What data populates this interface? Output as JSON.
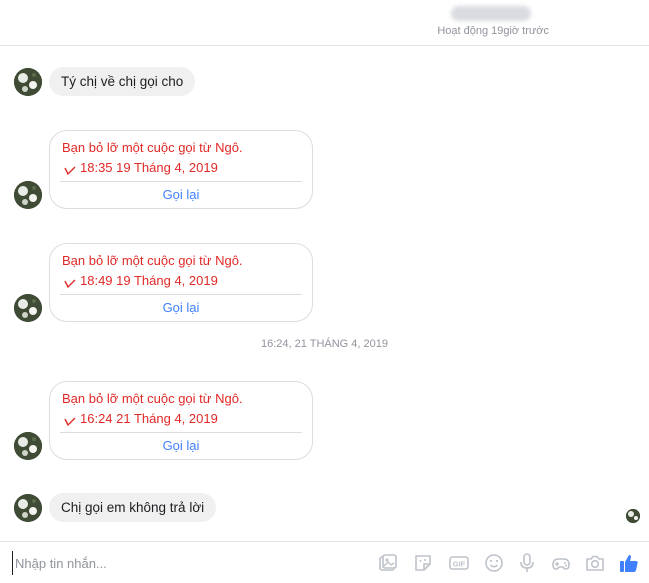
{
  "header": {
    "status": "Hoạt động 19giờ trước"
  },
  "messages": {
    "first": "Tý chị về chị gọi cho",
    "last": "Chị gọi em không trả lời"
  },
  "missed_calls": [
    {
      "title": "Bạn bỏ lỡ một cuộc gọi từ Ngô.",
      "time": "18:35 19 Tháng 4, 2019",
      "action": "Gọi lại"
    },
    {
      "title": "Bạn bỏ lỡ một cuộc gọi từ Ngô.",
      "time": "18:49 19 Tháng 4, 2019",
      "action": "Gọi lại"
    },
    {
      "title": "Bạn bỏ lỡ một cuộc gọi từ Ngô.",
      "time": "16:24 21 Tháng 4, 2019",
      "action": "Gọi lại"
    }
  ],
  "timestamp_divider": "16:24, 21 THÁNG 4, 2019",
  "composer": {
    "placeholder": "Nhập tin nhắn...",
    "tools": [
      "photo-icon",
      "sticker-icon",
      "gif-icon",
      "emoji-icon",
      "microphone-icon",
      "game-icon",
      "camera-icon",
      "like-icon"
    ]
  },
  "colors": {
    "missed_call": "#e02a28",
    "link": "#4080ff",
    "bubble": "#f1f0f0",
    "muted": "#90949c"
  }
}
